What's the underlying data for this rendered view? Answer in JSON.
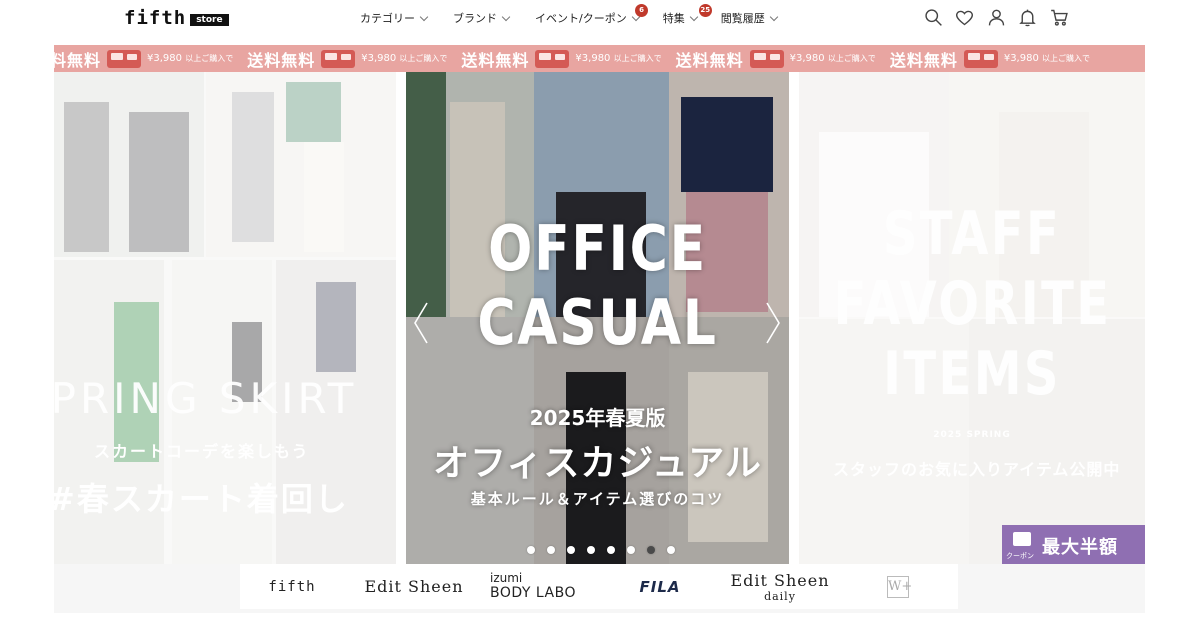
{
  "header": {
    "logo_text": "fifth",
    "logo_badge": "store",
    "nav": [
      {
        "label": "カテゴリー",
        "badge": ""
      },
      {
        "label": "ブランド",
        "badge": ""
      },
      {
        "label": "イベント/クーポン",
        "badge": "6"
      },
      {
        "label": "特集",
        "badge": "25"
      },
      {
        "label": "閲覧履歴",
        "badge": ""
      }
    ],
    "icons": [
      "search-icon",
      "heart-icon",
      "user-icon",
      "bell-icon",
      "cart-icon"
    ]
  },
  "shipping_banner": {
    "free_text": "送料無料",
    "price_text": "¥3,980",
    "condition_text": "以上ご購入で",
    "van_label": "¥0"
  },
  "carousel": {
    "left_slide": {
      "title": "SPRING SKIRT",
      "subtitle": "スカートコーデを楽しもう",
      "hashtag": "#春スカート着回し"
    },
    "center_slide": {
      "title_line1": "OFFICE",
      "title_line2": "CASUAL",
      "year_line": "2025年春夏版",
      "main_line": "オフィスカジュアル",
      "sub_line": "基本ルール＆アイテム選びのコツ"
    },
    "right_slide": {
      "title_line1": "STAFF",
      "title_line2": "FAVORITE",
      "title_line3": "ITEMS",
      "season": "2025 SPRING",
      "subtitle": "スタッフのお気に入りアイテム公開中"
    },
    "dot_count": 8,
    "active_dot": 7
  },
  "coupon_button": {
    "icon_label": "クーポン",
    "text": "最大半額"
  },
  "brands": {
    "fifth": "fifth",
    "edit_sheen": "Edit Sheen",
    "izumi_line1": "izumi",
    "izumi_line2": "BODY LABO",
    "fila": "FILA",
    "edit_sheen_daily_line1": "Edit Sheen",
    "edit_sheen_daily_line2": "daily",
    "wellness_mark": "W+"
  },
  "colors": {
    "banner_pink": "#e8a5a1",
    "badge_red": "#c0392b",
    "coupon_purple": "#8f6fb2",
    "active_dot": "#4a4a4a"
  }
}
